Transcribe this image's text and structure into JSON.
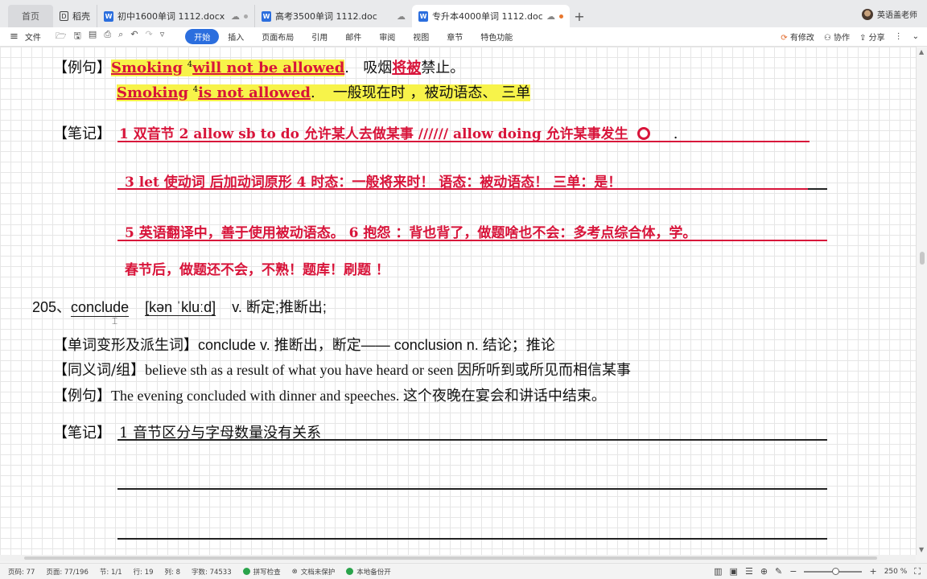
{
  "tabs": {
    "home": "首页",
    "shell": "稻壳",
    "docs": [
      {
        "title": "初中1600单词 1112.docx",
        "active": false,
        "dot": "gray"
      },
      {
        "title": "高考3500单词 1112.doc",
        "active": false,
        "dot": "none"
      },
      {
        "title": "专升本4000单词 1112.docx",
        "active": true,
        "dot": "orange"
      }
    ],
    "add": "+",
    "user_name": "英语盖老师"
  },
  "menubar": {
    "file": "文件",
    "menus": [
      "开始",
      "插入",
      "页面布局",
      "引用",
      "邮件",
      "审阅",
      "视图",
      "章节",
      "特色功能"
    ],
    "active_menu": "开始",
    "has_changes": "有修改",
    "collaborate": "协作",
    "share": "分享"
  },
  "document": {
    "ex1_label": "【例句】",
    "ex1_en_word": "Smoking",
    "ex1_sup": "4",
    "ex1_en_phrase": "will not be allowed",
    "ex1_period": ".",
    "ex1_cn_a": "吸烟",
    "ex1_cn_b": "将被",
    "ex1_cn_c": "禁止。",
    "ex2_en_word": "Smoking",
    "ex2_sup": "4",
    "ex2_en_phrase": "is not   allowed",
    "ex2_period": ".",
    "ex2_cn": "一般现在时    ，被动语态、  三单",
    "note_label": "【笔记】",
    "note1": "1 双音节   2    allow sb to do  允许某人去做某事         //////      allow    doing    允许某事发生",
    "note_tail": ".",
    "note2": "3 let    使动词      后加动词原形      4    时态：一般将来时！   语态：被动语态！     三单：是！",
    "note3": "5  英语翻译中，善于使用被动语态。    6  抱怨  ：背也背了，做题啥也不会：多考点综合体，学。",
    "note4": "春节后，做题还不会，不熟！题库！刷题  ！",
    "entry_num": "205、",
    "entry_word": "conclude",
    "entry_phonetic": "[kən ˈkluːd]",
    "entry_def": "v.  断定;推断出;",
    "deriv_label": "【单词变形及派生词】",
    "deriv_text": "conclude v.  推断出，断定——  conclusion n.  结论；推论",
    "syn_label": "【同义词/组】",
    "syn_text": "believe sth as a result of what you have heard or seen 因所听到或所见而相信某事",
    "ex3_label": "【例句】",
    "ex3_text": "The evening concluded with dinner and speeches.   这个夜晚在宴会和讲话中结束。",
    "note5_label": "【笔记】",
    "note5_text": "1  音节区分与字母数量没有关系"
  },
  "statusbar": {
    "page_num": "页码: 77",
    "pages": "页面: 77/196",
    "section": "节: 1/1",
    "row": "行: 19",
    "col": "列: 8",
    "words": "字数: 74533",
    "spell": "拼写检查",
    "protect": "文档未保护",
    "backup": "本地备份开",
    "zoom": "250 %",
    "zoom_level": 0.55
  },
  "colors": {
    "accent": "#2b6ede",
    "note_red": "#d8143a",
    "highlight": "#f7f34a"
  }
}
